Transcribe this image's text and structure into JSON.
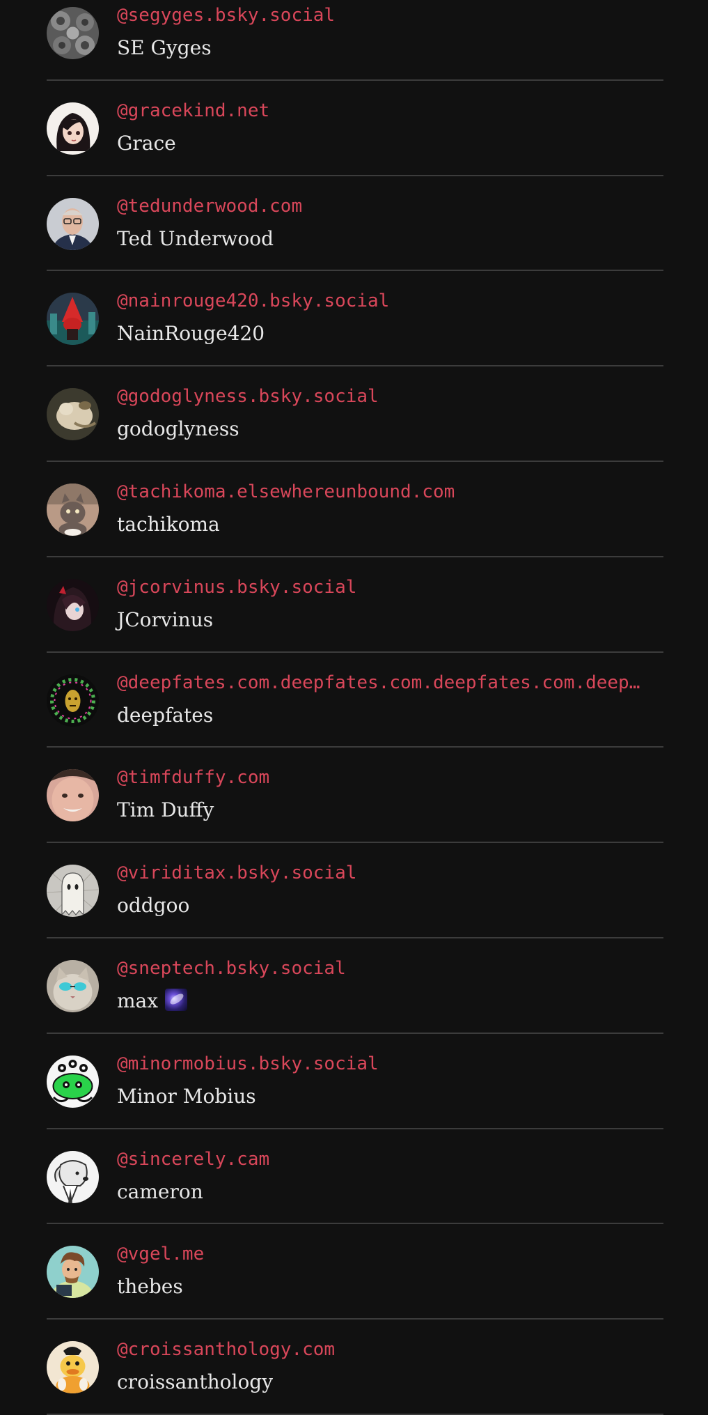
{
  "follows": [
    {
      "handle": "@segyges.bsky.social",
      "display_name": "SE Gyges",
      "avatar": "fractal-avatar"
    },
    {
      "handle": "@gracekind.net",
      "display_name": "Grace",
      "avatar": "anime-girl-avatar"
    },
    {
      "handle": "@tedunderwood.com",
      "display_name": "Ted Underwood",
      "avatar": "man-glasses-avatar"
    },
    {
      "handle": "@nainrouge420.bsky.social",
      "display_name": "NainRouge420",
      "avatar": "red-gnome-avatar"
    },
    {
      "handle": "@godoglyness.bsky.social",
      "display_name": "godoglyness",
      "avatar": "classical-painting-avatar"
    },
    {
      "handle": "@tachikoma.elsewhereunbound.com",
      "display_name": "tachikoma",
      "avatar": "cartoon-cat-avatar"
    },
    {
      "handle": "@jcorvinus.bsky.social",
      "display_name": "JCorvinus",
      "avatar": "anime-character-avatar"
    },
    {
      "handle": "@deepfates.com.deepfates.com.deepfates.com.deep…",
      "display_name": "deepfates",
      "avatar": "gold-mask-avatar"
    },
    {
      "handle": "@timfduffy.com",
      "display_name": "Tim Duffy",
      "avatar": "face-photo-avatar"
    },
    {
      "handle": "@viriditax.bsky.social",
      "display_name": "oddgoo",
      "avatar": "ghost-sketch-avatar"
    },
    {
      "handle": "@sneptech.bsky.social",
      "display_name": "max",
      "display_emoji": "milky-way-emoji",
      "avatar": "cat-sunglasses-avatar"
    },
    {
      "handle": "@minormobius.bsky.social",
      "display_name": "Minor Mobius",
      "avatar": "green-creature-avatar"
    },
    {
      "handle": "@sincerely.cam",
      "display_name": "cameron",
      "avatar": "dog-sketch-avatar"
    },
    {
      "handle": "@vgel.me",
      "display_name": "thebes",
      "avatar": "cartoon-person-avatar"
    },
    {
      "handle": "@croissanthology.com",
      "display_name": "croissanthology",
      "avatar": "duck-avatar"
    }
  ],
  "colors": {
    "background": "#111111",
    "handle": "#d9475a",
    "name": "#e8e8e8",
    "divider": "#3c3c3c"
  }
}
